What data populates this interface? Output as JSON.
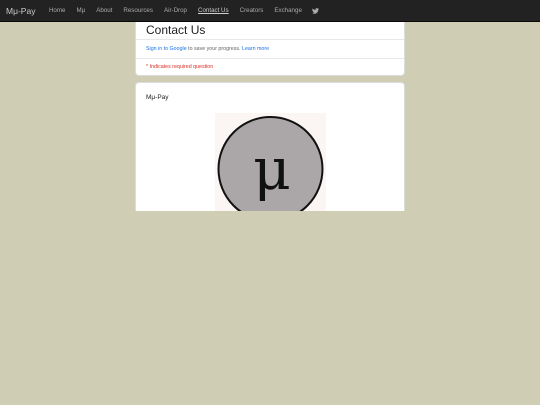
{
  "navbar": {
    "brand": "Mμ-Pay",
    "items": [
      {
        "label": "Home",
        "active": false
      },
      {
        "label": "Mμ",
        "active": false
      },
      {
        "label": "About",
        "active": false
      },
      {
        "label": "Resources",
        "active": false
      },
      {
        "label": "Air-Drop",
        "active": false
      },
      {
        "label": "Contact Us",
        "active": true
      },
      {
        "label": "Creators",
        "active": false
      },
      {
        "label": "Exchange",
        "active": false
      }
    ],
    "social_icon": "twitter-icon"
  },
  "form": {
    "title": "Contact Us",
    "sign_in_link": "Sign in to Google",
    "sign_in_suffix": " to save your progress. ",
    "learn_more": "Learn more",
    "required_note": "* Indicates required question",
    "question_title": "Mμ-Pay",
    "logo_symbol": "μ"
  },
  "colors": {
    "page_background": "#cfcdb4",
    "navbar": "#222222",
    "link": "#1a73e8",
    "required": "#d93025",
    "logo_fill": "#aba7a8"
  }
}
